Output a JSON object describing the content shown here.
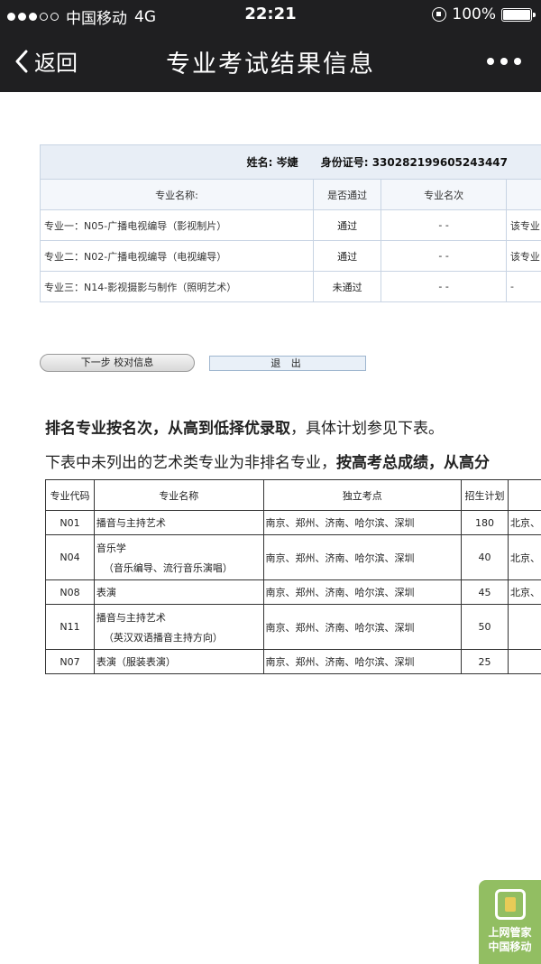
{
  "status_bar": {
    "carrier": "中国移动",
    "network": "4G",
    "time": "22:21",
    "battery": "100%"
  },
  "nav": {
    "back_label": "返回",
    "title": "专业考试结果信息"
  },
  "result": {
    "name_label": "姓名:",
    "name": "岑婕",
    "id_label": "身份证号:",
    "id": "330282199605243447",
    "headers": [
      "专业名称:",
      "是否通过",
      "专业名次"
    ],
    "rows": [
      {
        "major": "专业一：N05-广播电视编导（影视制片）",
        "passed": "通过",
        "rank": "- -",
        "extra": "该专业"
      },
      {
        "major": "专业二：N02-广播电视编导（电视编导）",
        "passed": "通过",
        "rank": "- -",
        "extra": "该专业"
      },
      {
        "major": "专业三：N14-影视摄影与制作（照明艺术）",
        "passed": "未通过",
        "rank": "- -",
        "extra": "-"
      }
    ]
  },
  "buttons": {
    "next": "下一步 校对信息",
    "exit": "退 出"
  },
  "notes": {
    "line1_bold": "排名专业按名次，从高到低择优录取",
    "line1_rest": "，具体计划参见下表。",
    "line2_pre": "下表中未列出的艺术类专业为非排名专业，",
    "line2_bold": "按高考总成绩，从高分"
  },
  "plan": {
    "headers": [
      "专业代码",
      "专业名称",
      "独立考点",
      "招生计划"
    ],
    "rows": [
      {
        "code": "N01",
        "name": "播音与主持艺术",
        "sub": "",
        "sites": "南京、郑州、济南、哈尔滨、深圳",
        "quota": "180",
        "extra": "北京、"
      },
      {
        "code": "N04",
        "name": "音乐学",
        "sub": "（音乐编导、流行音乐演唱）",
        "sites": "南京、郑州、济南、哈尔滨、深圳",
        "quota": "40",
        "extra": "北京、"
      },
      {
        "code": "N08",
        "name": "表演",
        "sub": "",
        "sites": "南京、郑州、济南、哈尔滨、深圳",
        "quota": "45",
        "extra": "北京、"
      },
      {
        "code": "N11",
        "name": "播音与主持艺术",
        "sub": "（英汉双语播音主持方向）",
        "sites": "南京、郑州、济南、哈尔滨、深圳",
        "quota": "50",
        "extra": ""
      },
      {
        "code": "N07",
        "name": "表演（服装表演）",
        "sub": "",
        "sites": "南京、郑州、济南、哈尔滨、深圳",
        "quota": "25",
        "extra": ""
      }
    ]
  },
  "badge": {
    "line1": "上网管家",
    "line2": "中国移动"
  },
  "colors": {
    "topbar": "#1f1f21",
    "table_header_bg": "#e8eef6",
    "badge": "#7fb347"
  }
}
